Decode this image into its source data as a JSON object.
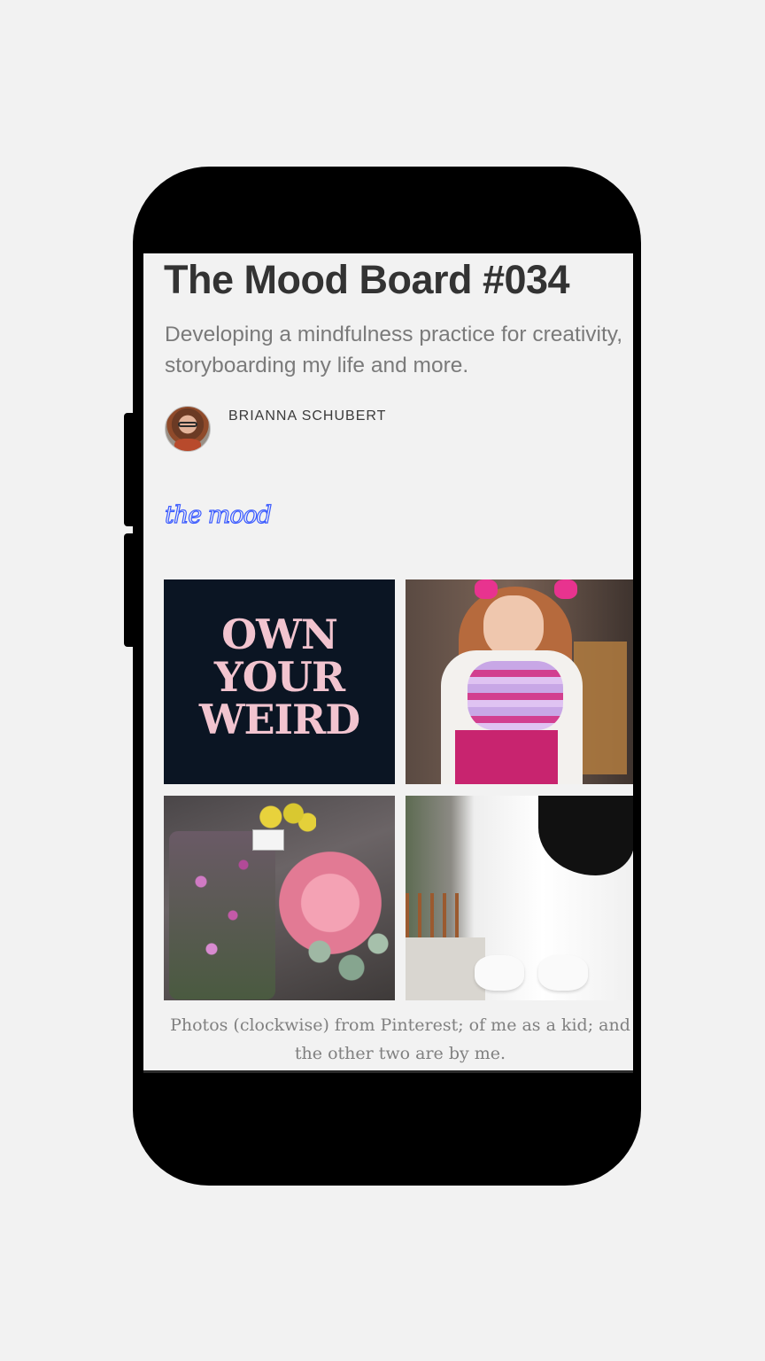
{
  "post": {
    "title": "The Mood Board #034",
    "subtitle": "Developing a mindfulness practice for creativity, storyboarding my life and more.",
    "author": "BRIANNA SCHUBERT"
  },
  "section": {
    "logo_text": "the mood",
    "logo_color": "#3b5bff"
  },
  "gallery": {
    "poster_lines": [
      "OWN",
      "YOUR",
      "WEIRD"
    ],
    "poster_color": "#f2c4cf",
    "caption": "Photos (clockwise) from Pinterest; of me as a kid; and the other two are by me."
  }
}
